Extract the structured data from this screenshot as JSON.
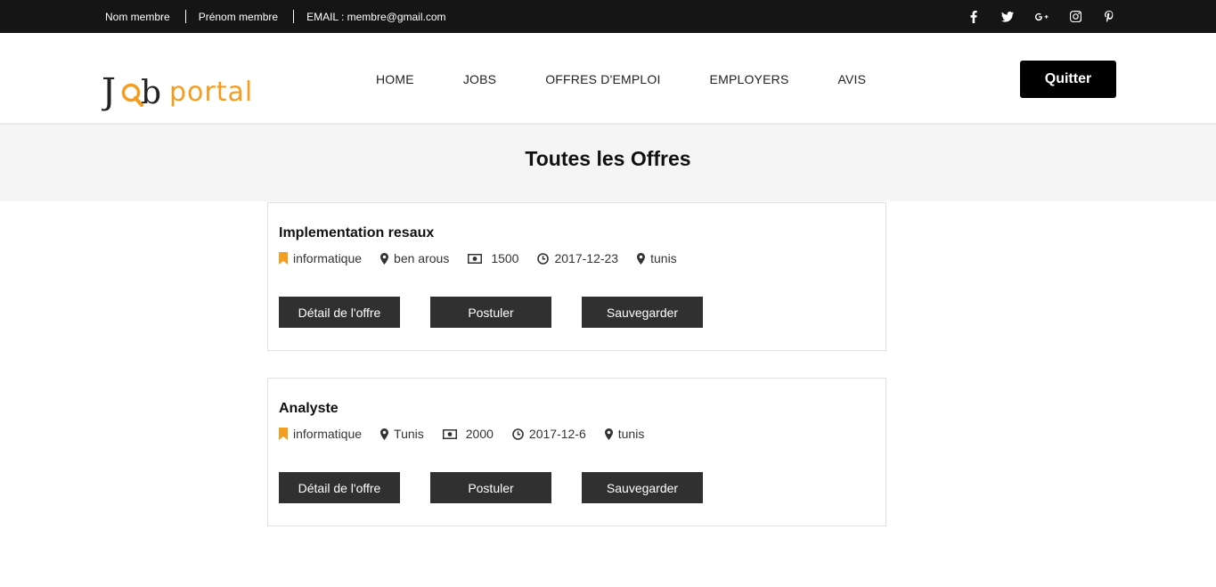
{
  "topbar": {
    "name": "Nom membre",
    "firstname": "Prénom membre",
    "email": "EMAIL : membre@gmail.com",
    "social": [
      "facebook-icon",
      "twitter-icon",
      "google-plus-icon",
      "instagram-icon",
      "pinterest-icon"
    ]
  },
  "brand": {
    "logo_part1": "Job",
    "logo_part2": "portal",
    "accent": "#f59d1f"
  },
  "nav": {
    "home": "HOME",
    "jobs": "JOBS",
    "offres": "OFFRES D'EMPLOI",
    "employers": "EMPLOYERS",
    "avis": "AVIS"
  },
  "quit_label": "Quitter",
  "page_title": "Toutes les Offres",
  "offers": [
    {
      "title": "Implementation resaux",
      "category": "informatique",
      "location": "ben arous",
      "salary": "1500",
      "date": "2017-12-23",
      "city": "tunis"
    },
    {
      "title": "Analyste",
      "category": "informatique",
      "location": "Tunis",
      "salary": "2000",
      "date": "2017-12-6",
      "city": "tunis"
    }
  ],
  "buttons": {
    "detail": "Détail de l'offre",
    "apply": "Postuler",
    "save": "Sauvegarder"
  }
}
